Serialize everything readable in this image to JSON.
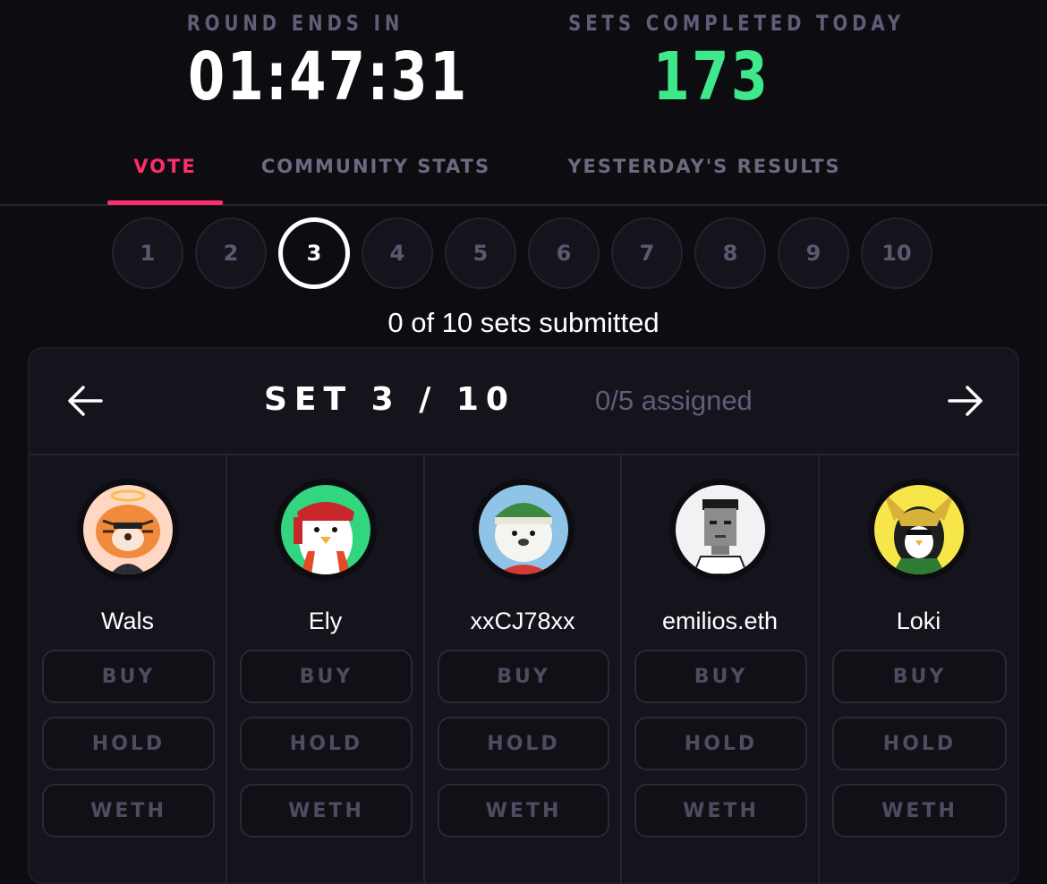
{
  "stats": {
    "round_label": "ROUND ENDS IN",
    "round_time": "01:47:31",
    "sets_label": "SETS COMPLETED TODAY",
    "sets_value": "173",
    "accent_green": "#3ee88b"
  },
  "tabs": [
    {
      "label": "VOTE",
      "active": true
    },
    {
      "label": "COMMUNITY STATS",
      "active": false
    },
    {
      "label": "YESTERDAY'S RESULTS",
      "active": false
    }
  ],
  "accent_pink": "#ff2d6a",
  "steps": [
    "1",
    "2",
    "3",
    "4",
    "5",
    "6",
    "7",
    "8",
    "9",
    "10"
  ],
  "current_step": "3",
  "submitted_text": "0 of 10 sets submitted",
  "set": {
    "title": "SET 3 / 10",
    "assigned": "0/5 assigned",
    "prev_icon": "arrow-left-icon",
    "next_icon": "arrow-right-icon"
  },
  "buttons": {
    "buy": "BUY",
    "hold": "HOLD",
    "weth": "WETH"
  },
  "members": [
    {
      "name": "Wals",
      "avatar": "tiger-halo-avatar"
    },
    {
      "name": "Ely",
      "avatar": "penguin-bandana-avatar"
    },
    {
      "name": "xxCJ78xx",
      "avatar": "bear-beanie-avatar"
    },
    {
      "name": "emilios.eth",
      "avatar": "pixel-man-avatar"
    },
    {
      "name": "Loki",
      "avatar": "penguin-loki-helmet-avatar"
    }
  ]
}
